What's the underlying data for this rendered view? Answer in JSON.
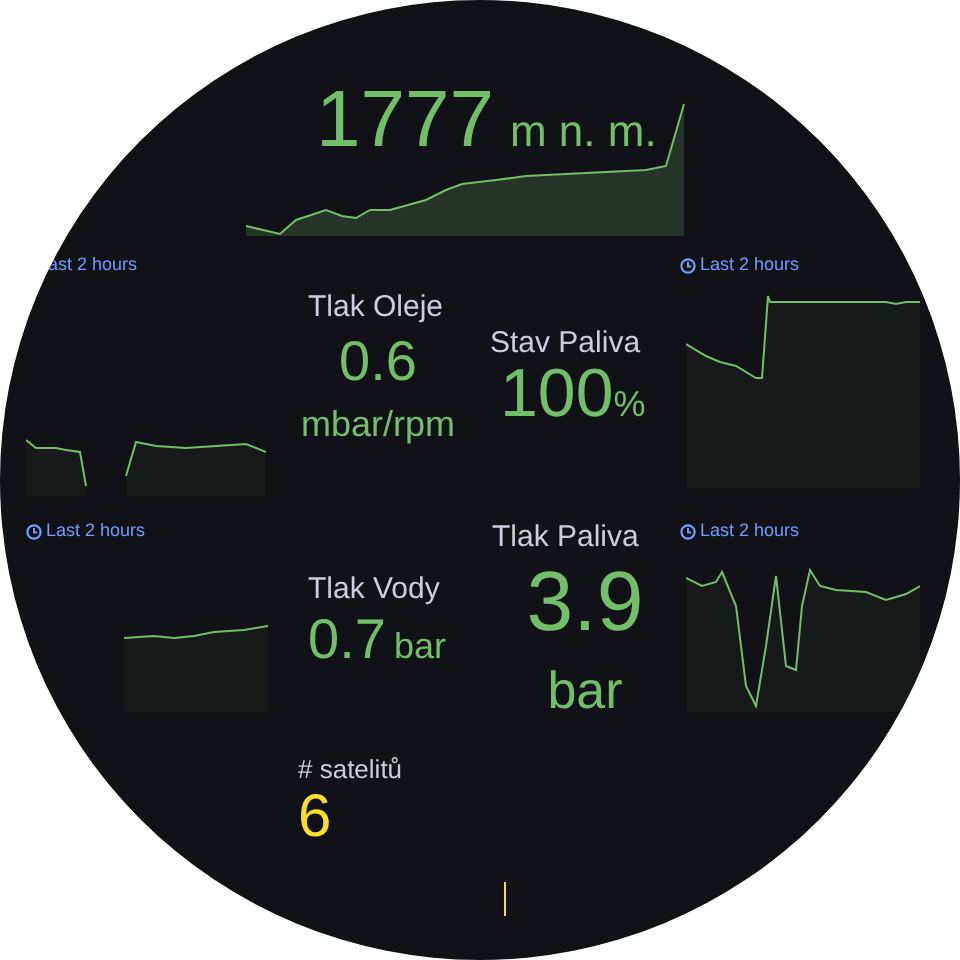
{
  "altitude": {
    "value": "1777",
    "unit": "m n. m.",
    "color": "#73bf69"
  },
  "time_labels": [
    {
      "text": "ast 2 hours",
      "clock_icon": false
    },
    {
      "text": "Last 2 hours",
      "clock_icon": true
    },
    {
      "text": "Last 2 hours",
      "clock_icon": true
    },
    {
      "text": "Last 2 hours",
      "clock_icon": true
    }
  ],
  "stats": [
    {
      "title": "Tlak Oleje",
      "value": "0.6",
      "unit": "mbar/rpm",
      "color": "#73bf69"
    },
    {
      "title": "Stav Paliva",
      "value": "100",
      "unit": "%",
      "color": "#73bf69"
    },
    {
      "title": "Tlak Vody",
      "value": "0.7",
      "unit": "bar",
      "color": "#73bf69"
    },
    {
      "title": "Tlak Paliva",
      "value": "3.9",
      "unit": "bar",
      "color": "#73bf69"
    },
    {
      "title": "# satelitů",
      "value": "6",
      "color": "#fade2a"
    }
  ]
}
